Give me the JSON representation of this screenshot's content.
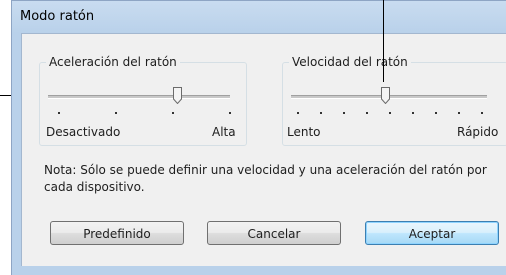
{
  "window": {
    "title": "Modo ratón"
  },
  "acceleration": {
    "legend": "Aceleración del ratón",
    "min_label": "Desactivado",
    "max_label": "Alta",
    "tick_count": 5,
    "value_position": 3
  },
  "speed": {
    "legend": "Velocidad del ratón",
    "min_label": "Lento",
    "max_label": "Rápido",
    "tick_count": 9,
    "value_position": 4
  },
  "note": {
    "text": "Nota: Sólo se puede definir una velocidad y una aceleración del ratón por cada dispositivo."
  },
  "buttons": {
    "default_label": "Predefinido",
    "cancel_label": "Cancelar",
    "accept_label": "Aceptar"
  }
}
